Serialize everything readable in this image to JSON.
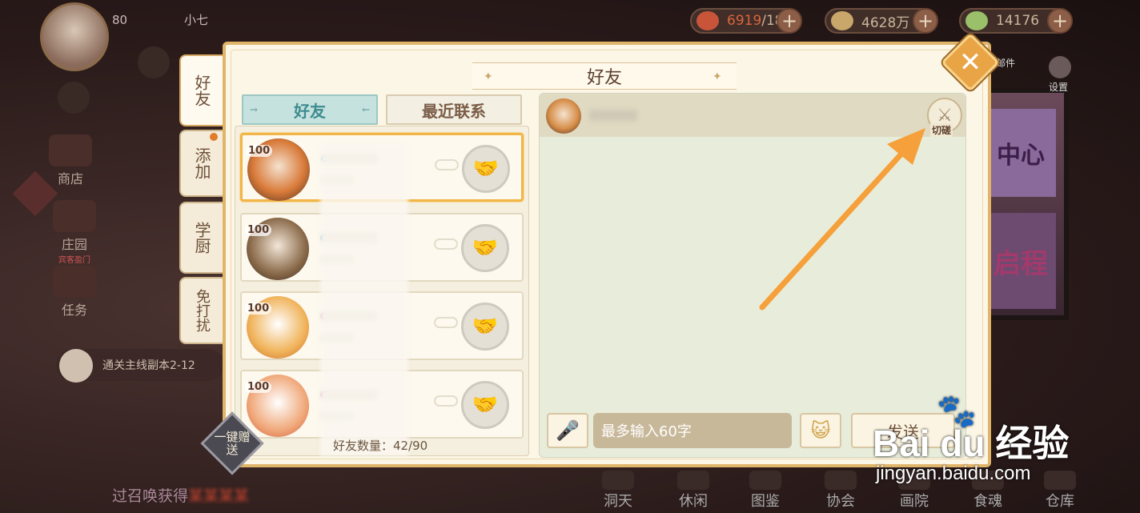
{
  "top": {
    "level": "80",
    "player_name": "小七",
    "stamina_current": "6919",
    "stamina_max": "/180",
    "coins": "4628万",
    "gems": "14176",
    "mail_label": "邮件",
    "settings_label": "设置"
  },
  "sidebar": {
    "shop": "商店",
    "manor": "庄园",
    "manor_sub": "宾客盈门",
    "tasks": "任务"
  },
  "quest_tip": "通关主线副本2-12",
  "bottom_news": {
    "prefix": "过召唤获得",
    "highlight": "某某某某"
  },
  "bottom_nav": [
    "洞天",
    "休闲",
    "图鉴",
    "协会",
    "画院",
    "食魂",
    "仓库"
  ],
  "vtabs": [
    {
      "label": "好友"
    },
    {
      "label": "添加"
    },
    {
      "label": "学厨"
    },
    {
      "label": "免打扰"
    }
  ],
  "panel": {
    "title": "好友",
    "close": "✕",
    "list_tabs": {
      "friends": "好友",
      "recent": "最近联系"
    },
    "friends": [
      {
        "level": "100",
        "online_color": "#8fc6e8",
        "avatar_color": "#d97b3a"
      },
      {
        "level": "100",
        "online_color": "#8fc6e8",
        "avatar_color": "#8a6a4a"
      },
      {
        "level": "100",
        "online_color": "#e9a3c9",
        "avatar_color": "#f0b35a"
      },
      {
        "level": "100",
        "online_color": "#e9a3c9",
        "avatar_color": "#f0a87a"
      }
    ],
    "friend_count": "好友数量：42/90",
    "send_all": "一键赠送",
    "duel_label": "切磋",
    "chat_placeholder": "最多输入60字",
    "send_label": "发送"
  },
  "watermark": {
    "brand": "Bai du 经验",
    "url": "jingyan.baidu.com"
  },
  "colors": {
    "accent": "#e8a445",
    "arrow": "#f5a03a",
    "teal_tab": "#3e8c90"
  },
  "icons": [
    "close-icon",
    "gift-icon",
    "microphone-icon",
    "emoji-icon",
    "duel-icon",
    "paw-icon"
  ]
}
